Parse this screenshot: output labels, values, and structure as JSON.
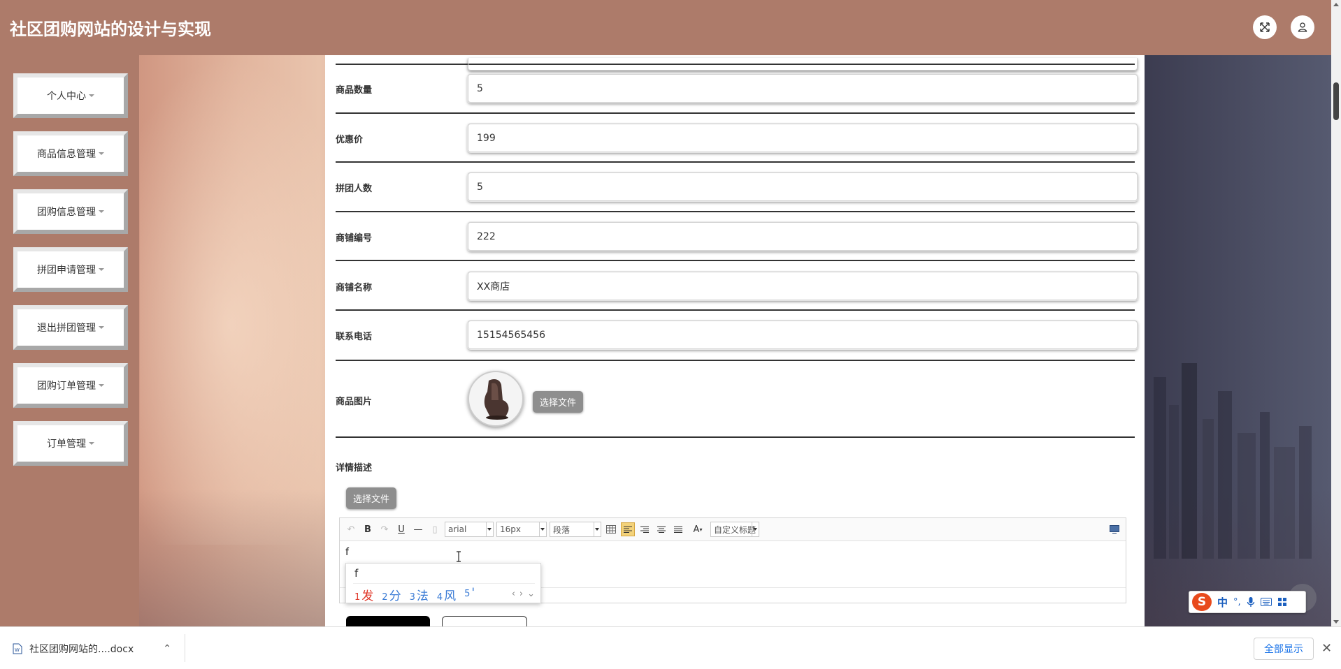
{
  "header": {
    "title": "社区团购网站的设计与实现"
  },
  "sidebar": {
    "items": [
      {
        "label": "个人中心"
      },
      {
        "label": "商品信息管理"
      },
      {
        "label": "团购信息管理"
      },
      {
        "label": "拼团申请管理"
      },
      {
        "label": "退出拼团管理"
      },
      {
        "label": "团购订单管理"
      },
      {
        "label": "订单管理"
      }
    ]
  },
  "form": {
    "fields": [
      {
        "label": "商品数量",
        "value": "5"
      },
      {
        "label": "优惠价",
        "value": "199"
      },
      {
        "label": "拼团人数",
        "value": "5"
      },
      {
        "label": "商铺编号",
        "value": "222"
      },
      {
        "label": "商铺名称",
        "value": "XX商店"
      },
      {
        "label": "联系电话",
        "value": "15154565456"
      }
    ],
    "image_label": "商品图片",
    "choose_file_label": "选择文件",
    "detail_label": "详情描述",
    "detail_choose_file_label": "选择文件"
  },
  "editor": {
    "font_family": "arial",
    "font_size": "16px",
    "paragraph": "段落",
    "custom_title": "自定义标题",
    "font_color_glyph": "A",
    "content": "f"
  },
  "ime": {
    "composition": "f",
    "candidates": [
      {
        "n": "1",
        "text": "发"
      },
      {
        "n": "2",
        "text": "分"
      },
      {
        "n": "3",
        "text": "法"
      },
      {
        "n": "4",
        "text": "风"
      },
      {
        "n": "5",
        "text": "'"
      }
    ],
    "status_logo": "S",
    "status_lang": "中",
    "status_punct": "°,"
  },
  "download_bar": {
    "filename": "社区团购网站的....docx",
    "show_all": "全部显示"
  },
  "colors": {
    "header_bg": "#ad7b6a",
    "sidebar_bg": "#ad7b6a",
    "ime_first": "#e0392b",
    "ime_cand": "#3a7bd5",
    "link_blue": "#1a73e8"
  }
}
